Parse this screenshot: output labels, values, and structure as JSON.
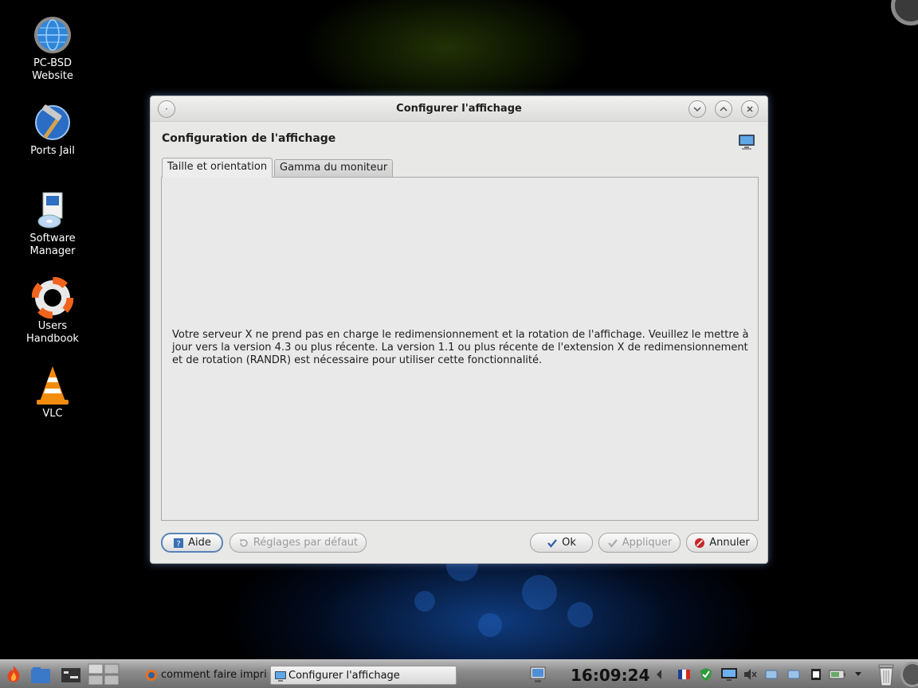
{
  "desktop": {
    "icons": [
      {
        "label": "PC-BSD\nWebsite",
        "icon": "globe-gear-icon"
      },
      {
        "label": "Ports Jail",
        "icon": "hammer-globe-icon"
      },
      {
        "label": "Software\nManager",
        "icon": "software-box-icon"
      },
      {
        "label": "Users\nHandbook",
        "icon": "lifebuoy-icon"
      },
      {
        "label": "VLC",
        "icon": "vlc-cone-icon"
      }
    ]
  },
  "dialog": {
    "title": "Configurer l'affichage",
    "header": "Configuration de l'affichage",
    "tabs": [
      {
        "label": "Taille et orientation",
        "active": true
      },
      {
        "label": "Gamma du moniteur",
        "active": false
      }
    ],
    "message": "Votre serveur X ne prend pas en charge le redimensionnement et la rotation de l'affichage. Veuillez le mettre à jour vers la version 4.3 ou plus récente. La version 1.1 ou plus récente de l'extension X de redimensionnement et de rotation (RANDR) est nécessaire pour utiliser cette fonctionnalité.",
    "buttons": {
      "help": "Aide",
      "defaults": "Réglages par défaut",
      "ok": "Ok",
      "apply": "Appliquer",
      "cancel": "Annuler"
    }
  },
  "taskbar": {
    "tasks": [
      {
        "label": "comment faire imprim",
        "active": false
      },
      {
        "label": "Configurer l'affichage",
        "active": true
      }
    ],
    "clock": "16:09:24"
  },
  "colors": {
    "dialog_bg": "#e8e8e7",
    "focus_ring": "#5a82b8",
    "ok_check": "#2f5fa5",
    "cancel_red": "#c62828"
  }
}
